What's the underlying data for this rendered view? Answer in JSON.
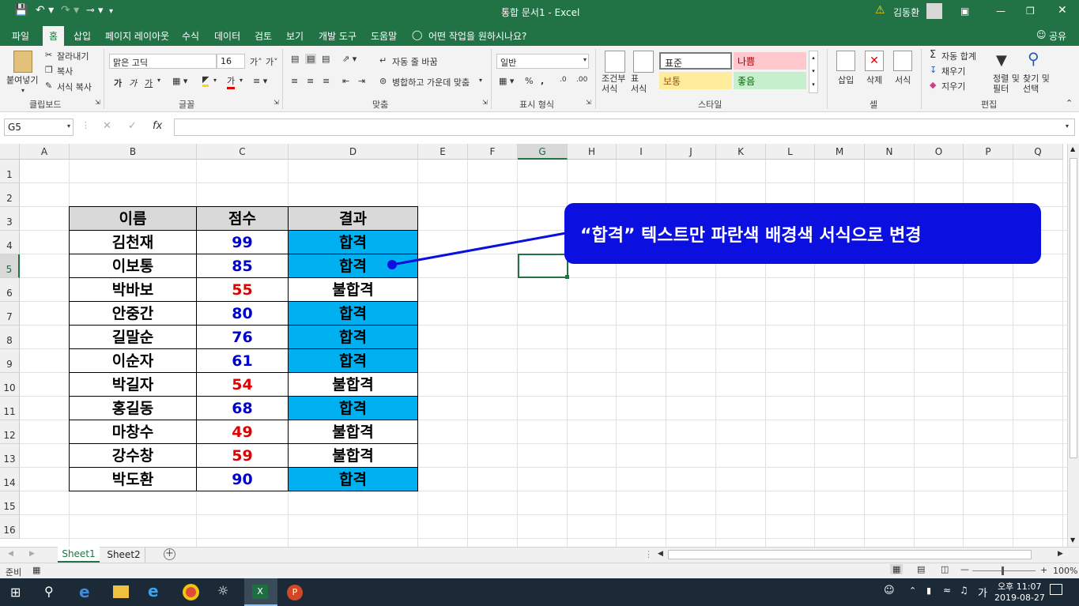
{
  "window": {
    "title": "통합 문서1  -  Excel",
    "user": "김동환"
  },
  "tabs": [
    "파일",
    "홈",
    "삽입",
    "페이지 레이아웃",
    "수식",
    "데이터",
    "검토",
    "보기",
    "개발 도구",
    "도움말"
  ],
  "tell_me": "어떤 작업을 원하시나요?",
  "share": "공유",
  "ribbon": {
    "clipboard": {
      "paste": "붙여넣기",
      "cut": "잘라내기",
      "copy": "복사",
      "format_painter": "서식 복사",
      "group": "클립보드"
    },
    "font": {
      "name": "맑은 고딕",
      "size": "16",
      "bold": "가",
      "italic": "가",
      "underline": "가",
      "group": "글꼴"
    },
    "alignment": {
      "wrap": "자동 줄 바꿈",
      "merge": "병합하고 가운데 맞춤",
      "group": "맞춤"
    },
    "number": {
      "format": "일반",
      "group": "표시 형식"
    },
    "styles": {
      "conditional": "조건부\n서식",
      "table": "표\n서식",
      "normal": "표준",
      "bad": "나쁨",
      "neutral": "보통",
      "good": "좋음",
      "group": "스타일"
    },
    "cells": {
      "insert": "삽입",
      "delete": "삭제",
      "format": "서식",
      "group": "셀"
    },
    "editing": {
      "autosum": "자동 합계",
      "fill": "채우기",
      "clear": "지우기",
      "sort": "정렬 및\n필터",
      "find": "찾기 및\n선택",
      "group": "편집"
    }
  },
  "formula_bar": {
    "name_box": "G5",
    "formula": ""
  },
  "columns": [
    "A",
    "B",
    "C",
    "D",
    "E",
    "F",
    "G",
    "H",
    "I",
    "J",
    "K",
    "L",
    "M",
    "N",
    "O",
    "P",
    "Q"
  ],
  "rows": [
    "1",
    "2",
    "3",
    "4",
    "5",
    "6",
    "7",
    "8",
    "9",
    "10",
    "11",
    "12",
    "13",
    "14",
    "15",
    "16"
  ],
  "table": {
    "headers": [
      "이름",
      "점수",
      "결과"
    ],
    "rows": [
      {
        "name": "김천재",
        "score": "99",
        "result": "합격"
      },
      {
        "name": "이보통",
        "score": "85",
        "result": "합격"
      },
      {
        "name": "박바보",
        "score": "55",
        "result": "불합격"
      },
      {
        "name": "안중간",
        "score": "80",
        "result": "합격"
      },
      {
        "name": "길말순",
        "score": "76",
        "result": "합격"
      },
      {
        "name": "이순자",
        "score": "61",
        "result": "합격"
      },
      {
        "name": "박길자",
        "score": "54",
        "result": "불합격"
      },
      {
        "name": "홍길동",
        "score": "68",
        "result": "합격"
      },
      {
        "name": "마창수",
        "score": "49",
        "result": "불합격"
      },
      {
        "name": "강수창",
        "score": "59",
        "result": "불합격"
      },
      {
        "name": "박도환",
        "score": "90",
        "result": "합격"
      }
    ]
  },
  "colors": {
    "excel_green": "#217346",
    "pass_fill": "#00b0f0",
    "score_high": "#0000cc",
    "score_low": "#e00000",
    "callout": "#0b10e0"
  },
  "callout": "“합격” 텍스트만 파란색 배경색 서식으로 변경",
  "sheets": [
    "Sheet1",
    "Sheet2"
  ],
  "status": {
    "ready": "준비",
    "zoom": "100%"
  },
  "taskbar": {
    "time": "오후 11:07",
    "date": "2019-08-27",
    "ime": "가"
  }
}
